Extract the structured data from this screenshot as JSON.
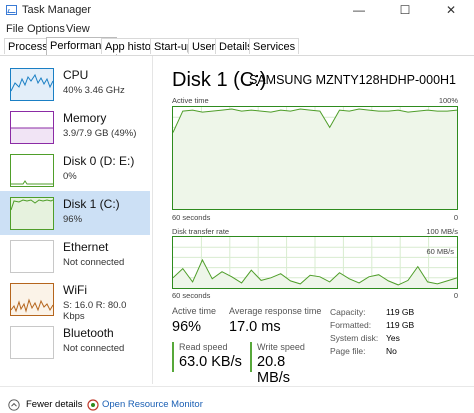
{
  "window": {
    "title": "Task Manager",
    "min": "—",
    "max": "☐",
    "close": "✕"
  },
  "menu": [
    "File",
    "Options",
    "View"
  ],
  "tabs": [
    "Processes",
    "Performance",
    "App history",
    "Start-up",
    "Users",
    "Details",
    "Services"
  ],
  "active_tab": "Performance",
  "sidebar": [
    {
      "name": "CPU",
      "detail": "40%  3.46 GHz",
      "color": "#1a7fc4",
      "fill": "#e3eef9"
    },
    {
      "name": "Memory",
      "detail": "3.9/7.9 GB (49%)",
      "color": "#8b2ba5",
      "fill": "#f1e4f5"
    },
    {
      "name": "Disk 0 (D: E:)",
      "detail": "0%",
      "color": "#4f9e2a",
      "fill": "#ffffff"
    },
    {
      "name": "Disk 1 (C:)",
      "detail": "96%",
      "color": "#4f9e2a",
      "fill": "#e6f2de"
    },
    {
      "name": "Ethernet",
      "detail": "Not connected",
      "color": "#aaaaaa",
      "fill": "#ffffff"
    },
    {
      "name": "WiFi",
      "detail": "S: 16.0  R: 80.0 Kbps",
      "color": "#b5651d",
      "fill": "#fbf3e8"
    },
    {
      "name": "Bluetooth",
      "detail": "Not connected",
      "color": "#aaaaaa",
      "fill": "#ffffff"
    }
  ],
  "main": {
    "title": "Disk 1 (C:)",
    "model": "SAMSUNG MZNTY128HDHP-000H1",
    "active_time_label": "Active time",
    "active_time_max": "100%",
    "seconds_label": "60 seconds",
    "zero_label": "0",
    "transfer_label": "Disk transfer rate",
    "transfer_max": "100 MB/s",
    "transfer_mid": "60 MB/s",
    "active_time_values": [
      75,
      96,
      97,
      95,
      96,
      97,
      98,
      96,
      97,
      96,
      95,
      97,
      96,
      98,
      97,
      96,
      80,
      97,
      96,
      98,
      97,
      96,
      96,
      97,
      95,
      96,
      97,
      96,
      96,
      97
    ],
    "transfer_values": [
      20,
      38,
      12,
      55,
      18,
      32,
      22,
      10,
      35,
      15,
      20,
      28,
      14,
      8,
      25,
      22,
      12,
      30,
      18,
      10,
      22,
      26,
      14,
      6,
      15,
      42,
      12,
      8,
      14,
      20
    ]
  },
  "stats": {
    "active_time_label": "Active time",
    "active_time_value": "96%",
    "response_label": "Average response time",
    "response_value": "17.0 ms",
    "read_label": "Read speed",
    "read_value": "63.0 KB/s",
    "write_label": "Write speed",
    "write_value": "20.8 MB/s"
  },
  "properties": [
    {
      "label": "Capacity:",
      "value": "119 GB"
    },
    {
      "label": "Formatted:",
      "value": "119 GB"
    },
    {
      "label": "System disk:",
      "value": "Yes"
    },
    {
      "label": "Page file:",
      "value": "No"
    }
  ],
  "footer": {
    "fewer": "Fewer details",
    "open": "Open Resource Monitor"
  }
}
